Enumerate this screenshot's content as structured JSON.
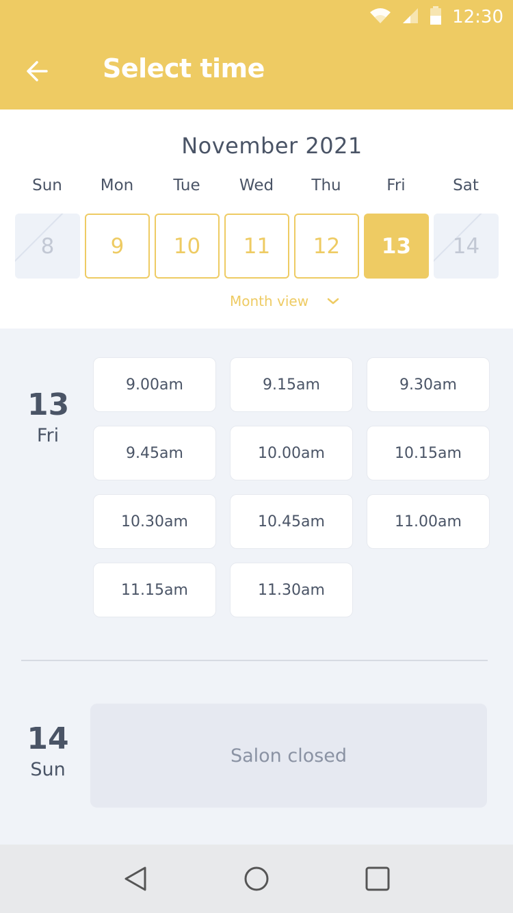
{
  "status_bar": {
    "time": "12:30"
  },
  "header": {
    "title": "Select time"
  },
  "calendar": {
    "month": "November 2021",
    "weekdays": [
      "Sun",
      "Mon",
      "Tue",
      "Wed",
      "Thu",
      "Fri",
      "Sat"
    ],
    "days": [
      {
        "label": "8",
        "state": "disabled"
      },
      {
        "label": "9",
        "state": "available"
      },
      {
        "label": "10",
        "state": "available"
      },
      {
        "label": "11",
        "state": "available"
      },
      {
        "label": "12",
        "state": "available"
      },
      {
        "label": "13",
        "state": "selected"
      },
      {
        "label": "14",
        "state": "disabled"
      }
    ],
    "month_view_label": "Month view"
  },
  "schedule": {
    "day1": {
      "date": "13",
      "weekday": "Fri",
      "slots": [
        "9.00am",
        "9.15am",
        "9.30am",
        "9.45am",
        "10.00am",
        "10.15am",
        "10.30am",
        "10.45am",
        "11.00am",
        "11.15am",
        "11.30am"
      ]
    },
    "day2": {
      "date": "14",
      "weekday": "Sun",
      "closed_label": "Salon closed"
    }
  },
  "colors": {
    "accent": "#eecb63",
    "text": "#4a5466",
    "background": "#f0f3f8"
  }
}
